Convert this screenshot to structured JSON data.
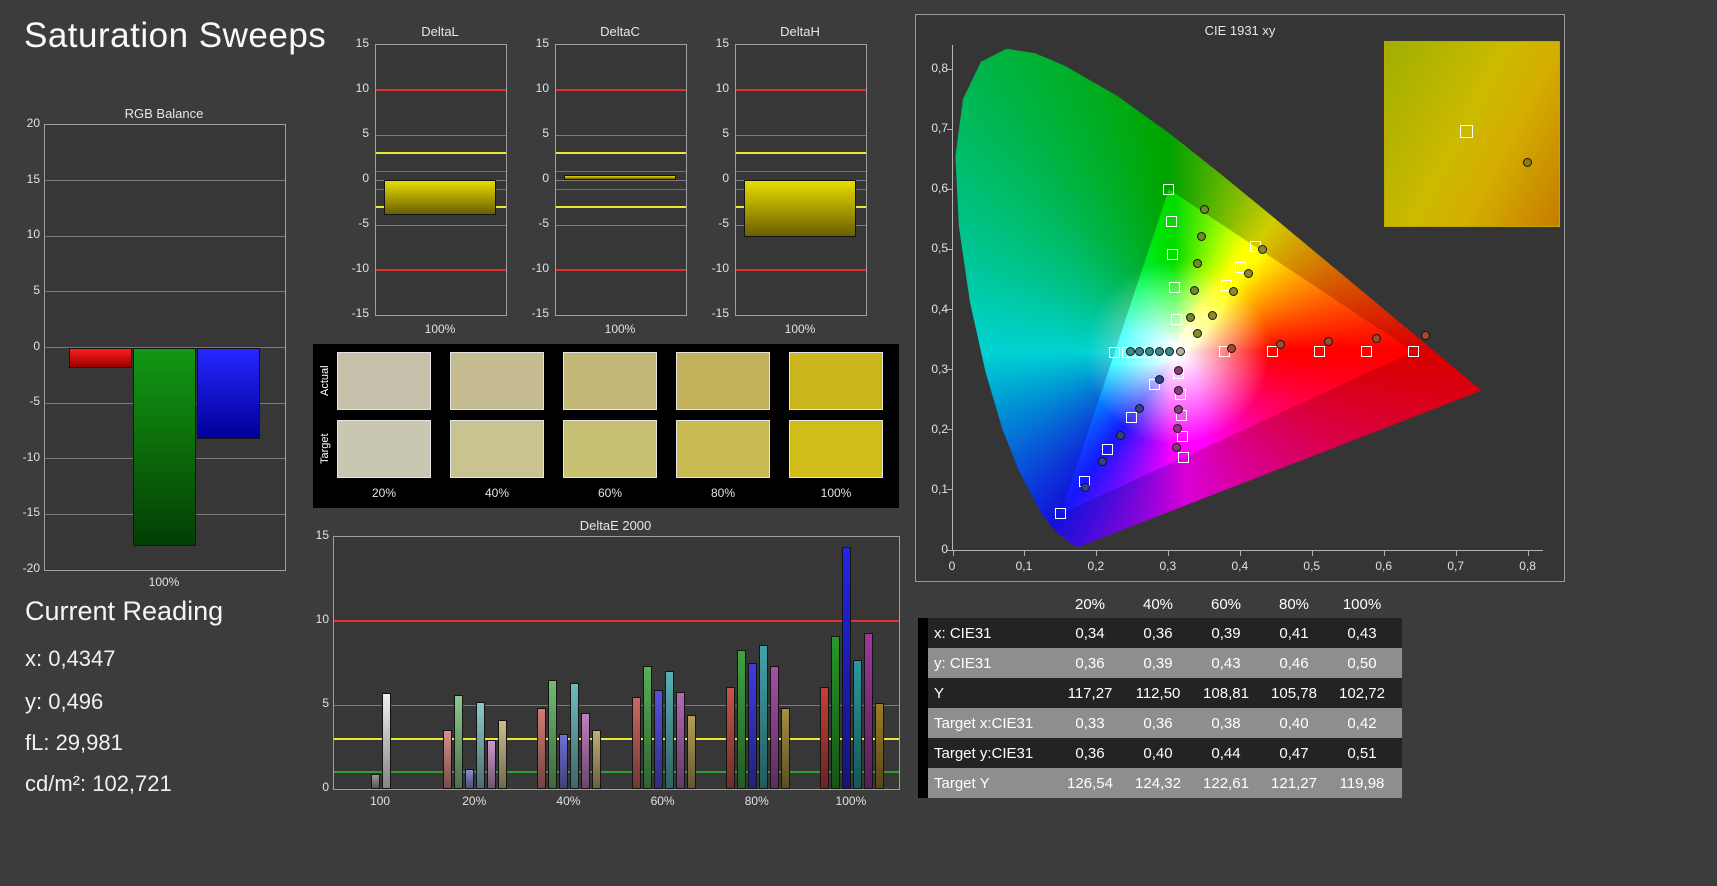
{
  "page": {
    "title": "Saturation Sweeps",
    "background": "#3c3c3c"
  },
  "current_reading": {
    "heading": "Current Reading",
    "x": "x: 0,4347",
    "y": "y: 0,496",
    "fl": "fL: 29,981",
    "cdm2": "cd/m²: 102,721"
  },
  "chart_data": [
    {
      "name": "rgb_balance",
      "type": "bar",
      "title": "RGB Balance",
      "categories": [
        "100%"
      ],
      "ylim": [
        -20,
        20
      ],
      "yticks": [
        20,
        15,
        10,
        5,
        0,
        -5,
        -10,
        -15,
        -20
      ],
      "series": [
        {
          "name": "red",
          "color_top": "#ff1e1e",
          "color_bottom": "#990000",
          "values": [
            -1.8
          ]
        },
        {
          "name": "green",
          "color_top": "#129912",
          "color_bottom": "#043e04",
          "values": [
            -17.8
          ]
        },
        {
          "name": "blue",
          "color_top": "#2626ff",
          "color_bottom": "#000099",
          "values": [
            -8.2
          ]
        }
      ]
    },
    {
      "name": "delta_l",
      "type": "bar",
      "title": "DeltaL",
      "xlabel": "100%",
      "ylim": [
        -15,
        15
      ],
      "yticks": [
        15,
        10,
        5,
        0,
        -5,
        -10,
        -15
      ],
      "value": -3.9,
      "bar_color_top": "#e8dc00",
      "bar_color_bottom": "#6a5e00",
      "ref_lines": [
        {
          "y": 10,
          "color": "#e23030",
          "weight": 2
        },
        {
          "y": 3,
          "color": "#e8e830",
          "weight": 2
        },
        {
          "y": 1,
          "color": "#2da02d",
          "weight": 1
        },
        {
          "y": -1,
          "color": "#2da02d",
          "weight": 1
        },
        {
          "y": -3,
          "color": "#e8e830",
          "weight": 2
        },
        {
          "y": -10,
          "color": "#e23030",
          "weight": 2
        }
      ]
    },
    {
      "name": "delta_c",
      "type": "bar",
      "title": "DeltaC",
      "xlabel": "100%",
      "ylim": [
        -15,
        15
      ],
      "yticks": [
        15,
        10,
        5,
        0,
        -5,
        -10,
        -15
      ],
      "value": 0.6,
      "bar_color_top": "#e8dc00",
      "bar_color_bottom": "#6a5e00",
      "ref_lines": [
        {
          "y": 10,
          "color": "#e23030",
          "weight": 2
        },
        {
          "y": 3,
          "color": "#e8e830",
          "weight": 2
        },
        {
          "y": 1,
          "color": "#2da02d",
          "weight": 1
        },
        {
          "y": -1,
          "color": "#2da02d",
          "weight": 1
        },
        {
          "y": -3,
          "color": "#e8e830",
          "weight": 2
        },
        {
          "y": -10,
          "color": "#e23030",
          "weight": 2
        }
      ]
    },
    {
      "name": "delta_h",
      "type": "bar",
      "title": "DeltaH",
      "xlabel": "100%",
      "ylim": [
        -15,
        15
      ],
      "yticks": [
        15,
        10,
        5,
        0,
        -5,
        -10,
        -15
      ],
      "value": -6.3,
      "bar_color_top": "#e8dc00",
      "bar_color_bottom": "#6a5e00",
      "ref_lines": [
        {
          "y": 10,
          "color": "#e23030",
          "weight": 2
        },
        {
          "y": 3,
          "color": "#e8e830",
          "weight": 2
        },
        {
          "y": 1,
          "color": "#2da02d",
          "weight": 1
        },
        {
          "y": -1,
          "color": "#2da02d",
          "weight": 1
        },
        {
          "y": -3,
          "color": "#e8e830",
          "weight": 2
        },
        {
          "y": -10,
          "color": "#e23030",
          "weight": 2
        }
      ]
    },
    {
      "name": "delta_e_2000",
      "type": "bar",
      "title": "DeltaE 2000",
      "ylim": [
        0,
        15
      ],
      "yticks": [
        15,
        10,
        5,
        0
      ],
      "gridlines": [
        5,
        10,
        15
      ],
      "ref_lines": [
        {
          "y": 10,
          "color": "#e23030",
          "weight": 2
        },
        {
          "y": 3,
          "color": "#e8e830",
          "weight": 2
        },
        {
          "y": 1,
          "color": "#2da02d",
          "weight": 2
        }
      ],
      "groups": [
        {
          "label": "100",
          "bars": [
            {
              "color": "#9a9a9a",
              "value": 0.9
            },
            {
              "color": "#f0f0f0",
              "value": 5.7
            }
          ]
        },
        {
          "label": "20%",
          "bars": [
            {
              "color": "#d4908a",
              "value": 3.5
            },
            {
              "color": "#8cc88c",
              "value": 5.6
            },
            {
              "color": "#8c8cd4",
              "value": 1.2
            },
            {
              "color": "#8cc8c8",
              "value": 5.2
            },
            {
              "color": "#cc98cc",
              "value": 2.9
            },
            {
              "color": "#ccbe8c",
              "value": 4.1
            }
          ]
        },
        {
          "label": "40%",
          "bars": [
            {
              "color": "#d07c74",
              "value": 4.8
            },
            {
              "color": "#70bc70",
              "value": 6.5
            },
            {
              "color": "#7070d8",
              "value": 3.3
            },
            {
              "color": "#70bcbe",
              "value": 6.3
            },
            {
              "color": "#c080c0",
              "value": 4.5
            },
            {
              "color": "#c0ae70",
              "value": 3.5
            }
          ]
        },
        {
          "label": "60%",
          "bars": [
            {
              "color": "#cc685e",
              "value": 5.5
            },
            {
              "color": "#58b058",
              "value": 7.3
            },
            {
              "color": "#5454dc",
              "value": 5.9
            },
            {
              "color": "#58b0b4",
              "value": 7.0
            },
            {
              "color": "#b468b4",
              "value": 5.8
            },
            {
              "color": "#b49e58",
              "value": 4.4
            }
          ]
        },
        {
          "label": "80%",
          "bars": [
            {
              "color": "#c85448",
              "value": 6.1
            },
            {
              "color": "#40a440",
              "value": 8.3
            },
            {
              "color": "#3c3ce0",
              "value": 7.5
            },
            {
              "color": "#40a4aa",
              "value": 8.6
            },
            {
              "color": "#a850a8",
              "value": 7.3
            },
            {
              "color": "#a88e40",
              "value": 4.8
            }
          ]
        },
        {
          "label": "100%",
          "bars": [
            {
              "color": "#c44038",
              "value": 6.1
            },
            {
              "color": "#289828",
              "value": 9.1
            },
            {
              "color": "#2424e4",
              "value": 14.4
            },
            {
              "color": "#28989e",
              "value": 7.7
            },
            {
              "color": "#9c389c",
              "value": 9.3
            },
            {
              "color": "#9c7e28",
              "value": 5.1
            }
          ]
        }
      ]
    },
    {
      "name": "cie_1931",
      "type": "scatter",
      "title": "CIE 1931 xy",
      "xlim": [
        0,
        0.8
      ],
      "ylim": [
        0,
        0.8
      ],
      "xticks": [
        {
          "v": 0,
          "label": "0"
        },
        {
          "v": 0.1,
          "label": "0,1"
        },
        {
          "v": 0.2,
          "label": "0,2"
        },
        {
          "v": 0.3,
          "label": "0,3"
        },
        {
          "v": 0.4,
          "label": "0,4"
        },
        {
          "v": 0.5,
          "label": "0,5"
        },
        {
          "v": 0.6,
          "label": "0,6"
        },
        {
          "v": 0.7,
          "label": "0,7"
        },
        {
          "v": 0.8,
          "label": "0,8"
        }
      ],
      "yticks": [
        {
          "v": 0.8,
          "label": "0,8"
        },
        {
          "v": 0.7,
          "label": "0,7"
        },
        {
          "v": 0.6,
          "label": "0,6"
        },
        {
          "v": 0.5,
          "label": "0,5"
        },
        {
          "v": 0.4,
          "label": "0,4"
        },
        {
          "v": 0.3,
          "label": "0,3"
        },
        {
          "v": 0.2,
          "label": "0,2"
        },
        {
          "v": 0.1,
          "label": "0,1"
        },
        {
          "v": 0,
          "label": "0"
        }
      ],
      "gamut_triangle": {
        "red": [
          0.64,
          0.33
        ],
        "green": [
          0.3,
          0.6
        ],
        "blue": [
          0.15,
          0.06
        ]
      },
      "white_point": [
        0.3127,
        0.329
      ],
      "targets": {
        "marker": "square",
        "points": [
          [
            0.313,
            0.329
          ],
          [
            0.378,
            0.33
          ],
          [
            0.444,
            0.33
          ],
          [
            0.509,
            0.33
          ],
          [
            0.575,
            0.33
          ],
          [
            0.64,
            0.33
          ],
          [
            0.31,
            0.383
          ],
          [
            0.308,
            0.437
          ],
          [
            0.305,
            0.492
          ],
          [
            0.303,
            0.546
          ],
          [
            0.3,
            0.6
          ],
          [
            0.28,
            0.275
          ],
          [
            0.248,
            0.221
          ],
          [
            0.215,
            0.167
          ],
          [
            0.183,
            0.114
          ],
          [
            0.15,
            0.06
          ],
          [
            0.295,
            0.329
          ],
          [
            0.278,
            0.329
          ],
          [
            0.26,
            0.329
          ],
          [
            0.242,
            0.329
          ],
          [
            0.225,
            0.329
          ],
          [
            0.314,
            0.294
          ],
          [
            0.316,
            0.259
          ],
          [
            0.318,
            0.224
          ],
          [
            0.319,
            0.189
          ],
          [
            0.321,
            0.154
          ],
          [
            0.33,
            0.36
          ],
          [
            0.355,
            0.395
          ],
          [
            0.38,
            0.44
          ],
          [
            0.4,
            0.47
          ],
          [
            0.42,
            0.505
          ]
        ]
      },
      "measurements": [
        {
          "sweep": "white",
          "color": "#b0b0a0",
          "points": [
            [
              0.316,
              0.331
            ]
          ]
        },
        {
          "sweep": "red",
          "color": "#a04a30",
          "points": [
            [
              0.387,
              0.336
            ],
            [
              0.455,
              0.341
            ],
            [
              0.522,
              0.346
            ],
            [
              0.589,
              0.351
            ],
            [
              0.656,
              0.357
            ]
          ]
        },
        {
          "sweep": "green",
          "color": "#6f8a28",
          "points": [
            [
              0.33,
              0.386
            ],
            [
              0.335,
              0.431
            ],
            [
              0.34,
              0.476
            ],
            [
              0.345,
              0.521
            ],
            [
              0.35,
              0.566
            ]
          ]
        },
        {
          "sweep": "blue",
          "color": "#32428a",
          "points": [
            [
              0.287,
              0.283
            ],
            [
              0.259,
              0.236
            ],
            [
              0.233,
              0.191
            ],
            [
              0.208,
              0.147
            ],
            [
              0.184,
              0.104
            ]
          ]
        },
        {
          "sweep": "cyan",
          "color": "#3a8a8a",
          "points": [
            [
              0.301,
              0.331
            ],
            [
              0.287,
              0.33
            ],
            [
              0.273,
              0.33
            ],
            [
              0.259,
              0.33
            ],
            [
              0.246,
              0.331
            ]
          ]
        },
        {
          "sweep": "magenta",
          "color": "#8a3a7a",
          "points": [
            [
              0.314,
              0.298
            ],
            [
              0.313,
              0.266
            ],
            [
              0.313,
              0.234
            ],
            [
              0.312,
              0.202
            ],
            [
              0.311,
              0.171
            ]
          ]
        },
        {
          "sweep": "yellow",
          "color": "#8a8a2a",
          "points": [
            [
              0.34,
              0.36
            ],
            [
              0.36,
              0.39
            ],
            [
              0.39,
              0.43
            ],
            [
              0.41,
              0.46
            ],
            [
              0.43,
              0.5
            ]
          ]
        }
      ],
      "inset": {
        "square": [
          0.47,
          0.49
        ],
        "dot": [
          0.82,
          0.66
        ],
        "dot_color": "#8a7a10"
      }
    }
  ],
  "swatches": {
    "row_labels": [
      "Actual",
      "Target"
    ],
    "col_labels": [
      "20%",
      "40%",
      "60%",
      "80%",
      "100%"
    ],
    "actual": [
      "#c6c0ab",
      "#c5bc92",
      "#c4b878",
      "#c2b259",
      "#cbb61d"
    ],
    "target": [
      "#c9c7b2",
      "#c8c391",
      "#c7bf72",
      "#c6ba50",
      "#d0bd1a"
    ]
  },
  "table": {
    "col_headers": [
      "20%",
      "40%",
      "60%",
      "80%",
      "100%"
    ],
    "rows": [
      {
        "label": "x: CIE31",
        "values": [
          "0,34",
          "0,36",
          "0,39",
          "0,41",
          "0,43"
        ]
      },
      {
        "label": "y: CIE31",
        "values": [
          "0,36",
          "0,39",
          "0,43",
          "0,46",
          "0,50"
        ]
      },
      {
        "label": "Y",
        "values": [
          "117,27",
          "112,50",
          "108,81",
          "105,78",
          "102,72"
        ]
      },
      {
        "label": "Target x:CIE31",
        "values": [
          "0,33",
          "0,36",
          "0,38",
          "0,40",
          "0,42"
        ]
      },
      {
        "label": "Target y:CIE31",
        "values": [
          "0,36",
          "0,40",
          "0,44",
          "0,47",
          "0,51"
        ]
      },
      {
        "label": "Target Y",
        "values": [
          "126,54",
          "124,32",
          "122,61",
          "121,27",
          "119,98"
        ]
      }
    ]
  }
}
